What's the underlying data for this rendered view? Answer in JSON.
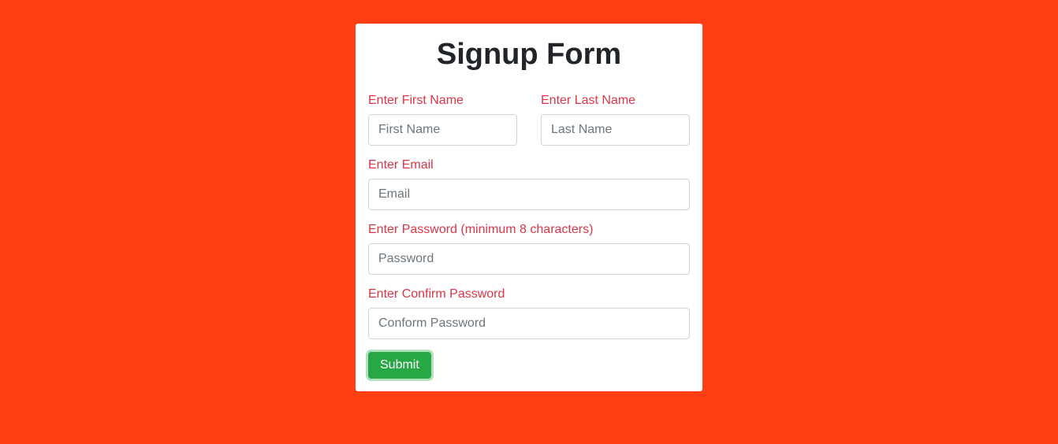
{
  "form": {
    "title": "Signup Form",
    "firstName": {
      "label": "Enter First Name",
      "placeholder": "First Name"
    },
    "lastName": {
      "label": "Enter Last Name",
      "placeholder": "Last Name"
    },
    "email": {
      "label": "Enter Email",
      "placeholder": "Email"
    },
    "password": {
      "label": "Enter Password (minimum 8 characters)",
      "placeholder": "Password"
    },
    "confirmPassword": {
      "label": "Enter Confirm Password",
      "placeholder": "Conform Password"
    },
    "submitLabel": "Submit"
  }
}
